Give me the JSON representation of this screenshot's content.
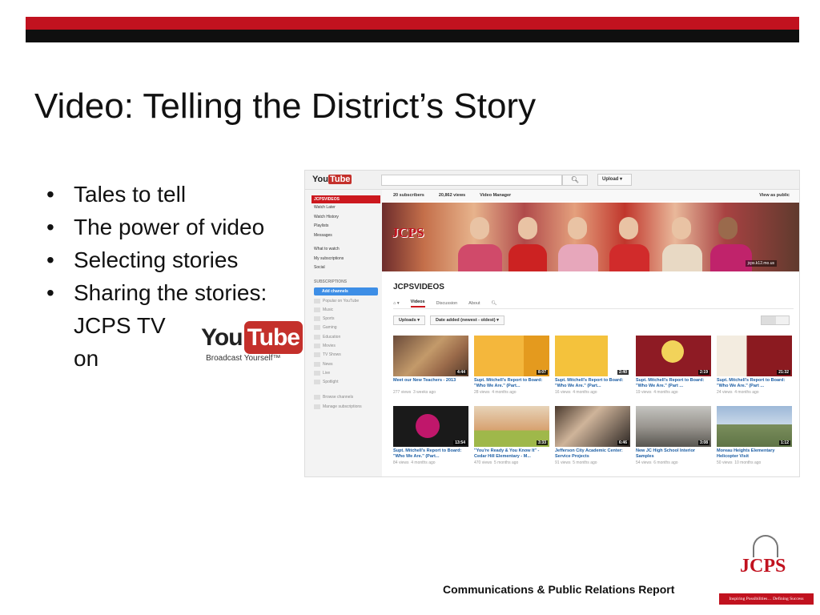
{
  "slide": {
    "title": "Video:  Telling the District’s Story",
    "bullets": [
      "Tales to tell",
      "The power of video",
      "Selecting stories",
      "Sharing the stories:"
    ],
    "bullet_continuation": "JCPS TV on",
    "youtube_logo": {
      "you": "You",
      "tube": "Tube",
      "tagline": "Broadcast Yourself™"
    },
    "footer": "Communications  & Public Relations Report",
    "logo": {
      "text": "JCPS",
      "tagline": "Inspiring Possibilities… Defining Success"
    }
  },
  "youtube": {
    "brand": {
      "you": "You",
      "tube": "Tube"
    },
    "search_icon": "search-icon",
    "upload_label": "Upload",
    "sidebar": {
      "header": "JCPSVIDEOS",
      "items": [
        "Watch Later",
        "Watch History",
        "Playlists",
        "Messages"
      ],
      "items2": [
        "What to watch",
        "My subscriptions",
        "Social"
      ],
      "subscriptions_label": "SUBSCRIPTIONS",
      "add_channels": "Add channels",
      "channels": [
        "Popular on YouTube",
        "Music",
        "Sports",
        "Gaming",
        "Education",
        "Movies",
        "TV Shows",
        "News",
        "Live",
        "Spotlight"
      ],
      "bottom": [
        "Browse channels",
        "Manage subscriptions"
      ]
    },
    "stats": {
      "subscribers": "20 subscribers",
      "views": "20,862 views",
      "video_manager": "Video Manager",
      "view_as_public": "View as public"
    },
    "banner": {
      "logo": "JCPS",
      "site": "jcps.k12.mo.us"
    },
    "channel_name": "JCPSVIDEOS",
    "tabs": [
      "Videos",
      "Discussion",
      "About"
    ],
    "filters": [
      "Uploads",
      "Date added (newest - oldest)"
    ],
    "videos": [
      {
        "title": "Meet our New Teachers - 2013",
        "views": "277 views",
        "age": "3 weeks ago",
        "duration": "4:44"
      },
      {
        "title": "Supt. Mitchell's Report to Board: \"Who We Are.\" (Part...",
        "views": "28 views",
        "age": "4 months ago",
        "duration": "8:07"
      },
      {
        "title": "Supt. Mitchell's Report to Board: \"Who We Are.\" (Part...",
        "views": "16 views",
        "age": "4 months ago",
        "duration": "2:40"
      },
      {
        "title": "Supt. Mitchell's Report to Board: \"Who We Are.\" (Part ...",
        "views": "19 views",
        "age": "4 months ago",
        "duration": "2:19"
      },
      {
        "title": "Supt. Mitchell's Report to Board: \"Who We Are.\" (Part ...",
        "views": "24 views",
        "age": "4 months ago",
        "duration": "21:32"
      },
      {
        "title": "Supt. Mitchell's Report to Board: \"Who We Are.\" (Part...",
        "views": "84 views",
        "age": "4 months ago",
        "duration": "13:54"
      },
      {
        "title": "\"You're Ready & You Know It\" - Cedar Hill Elementary - M...",
        "views": "470 views",
        "age": "5 months ago",
        "duration": "3:33"
      },
      {
        "title": "Jefferson City Academic Center: Service Projects",
        "views": "91 views",
        "age": "5 months ago",
        "duration": "6:46"
      },
      {
        "title": "New JC High School Interior Samples",
        "views": "54 views",
        "age": "6 months ago",
        "duration": "3:08"
      },
      {
        "title": "Moreau Heights Elementary Helicopter Visit",
        "views": "50 views",
        "age": "10 months ago",
        "duration": "1:12"
      }
    ]
  }
}
